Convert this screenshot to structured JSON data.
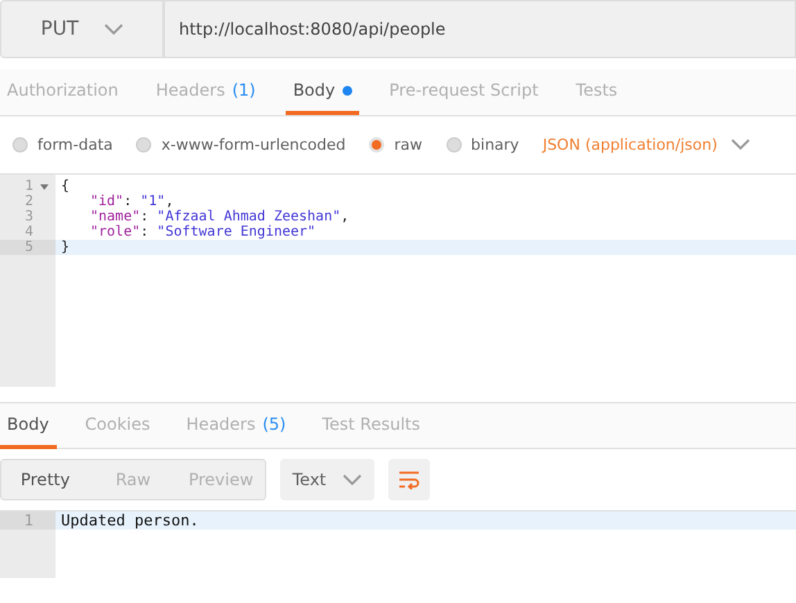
{
  "request": {
    "method": "PUT",
    "url": "http://localhost:8080/api/people"
  },
  "request_tabs": [
    {
      "label": "Authorization",
      "selected": false
    },
    {
      "label": "Headers",
      "count": "(1)",
      "selected": false
    },
    {
      "label": "Body",
      "modified": true,
      "selected": true
    },
    {
      "label": "Pre-request Script",
      "selected": false
    },
    {
      "label": "Tests",
      "selected": false
    }
  ],
  "body_modes": [
    {
      "label": "form-data",
      "selected": false
    },
    {
      "label": "x-www-form-urlencoded",
      "selected": false
    },
    {
      "label": "raw",
      "selected": true
    },
    {
      "label": "binary",
      "selected": false
    }
  ],
  "content_type": "JSON (application/json)",
  "request_editor": [
    {
      "number": "1",
      "foldable": true,
      "indented": false,
      "active": false,
      "tokens": [
        {
          "kind": "punct",
          "text": "{"
        }
      ]
    },
    {
      "number": "2",
      "foldable": false,
      "indented": true,
      "active": false,
      "tokens": [
        {
          "kind": "key",
          "text": "\"id\""
        },
        {
          "kind": "punct",
          "text": ": "
        },
        {
          "kind": "string",
          "text": "\"1\""
        },
        {
          "kind": "punct",
          "text": ","
        }
      ]
    },
    {
      "number": "3",
      "foldable": false,
      "indented": true,
      "active": false,
      "tokens": [
        {
          "kind": "key",
          "text": "\"name\""
        },
        {
          "kind": "punct",
          "text": ": "
        },
        {
          "kind": "string",
          "text": "\"Afzaal Ahmad Zeeshan\""
        },
        {
          "kind": "punct",
          "text": ","
        }
      ]
    },
    {
      "number": "4",
      "foldable": false,
      "indented": true,
      "active": false,
      "tokens": [
        {
          "kind": "key",
          "text": "\"role\""
        },
        {
          "kind": "punct",
          "text": ": "
        },
        {
          "kind": "string",
          "text": "\"Software Engineer\""
        }
      ]
    },
    {
      "number": "5",
      "foldable": false,
      "indented": false,
      "active": true,
      "tokens": [
        {
          "kind": "punct",
          "text": "}"
        }
      ]
    }
  ],
  "response_tabs": [
    {
      "label": "Body",
      "selected": true
    },
    {
      "label": "Cookies",
      "selected": false
    },
    {
      "label": "Headers",
      "count": "(5)",
      "selected": false
    },
    {
      "label": "Test Results",
      "selected": false
    }
  ],
  "view_modes": [
    {
      "label": "Pretty",
      "selected": true
    },
    {
      "label": "Raw",
      "selected": false
    },
    {
      "label": "Preview",
      "selected": false
    }
  ],
  "response_format": "Text",
  "response_editor": [
    {
      "number": "1",
      "foldable": false,
      "indented": false,
      "active": true,
      "tokens": [
        {
          "kind": "plain",
          "text": "Updated person."
        }
      ]
    }
  ]
}
